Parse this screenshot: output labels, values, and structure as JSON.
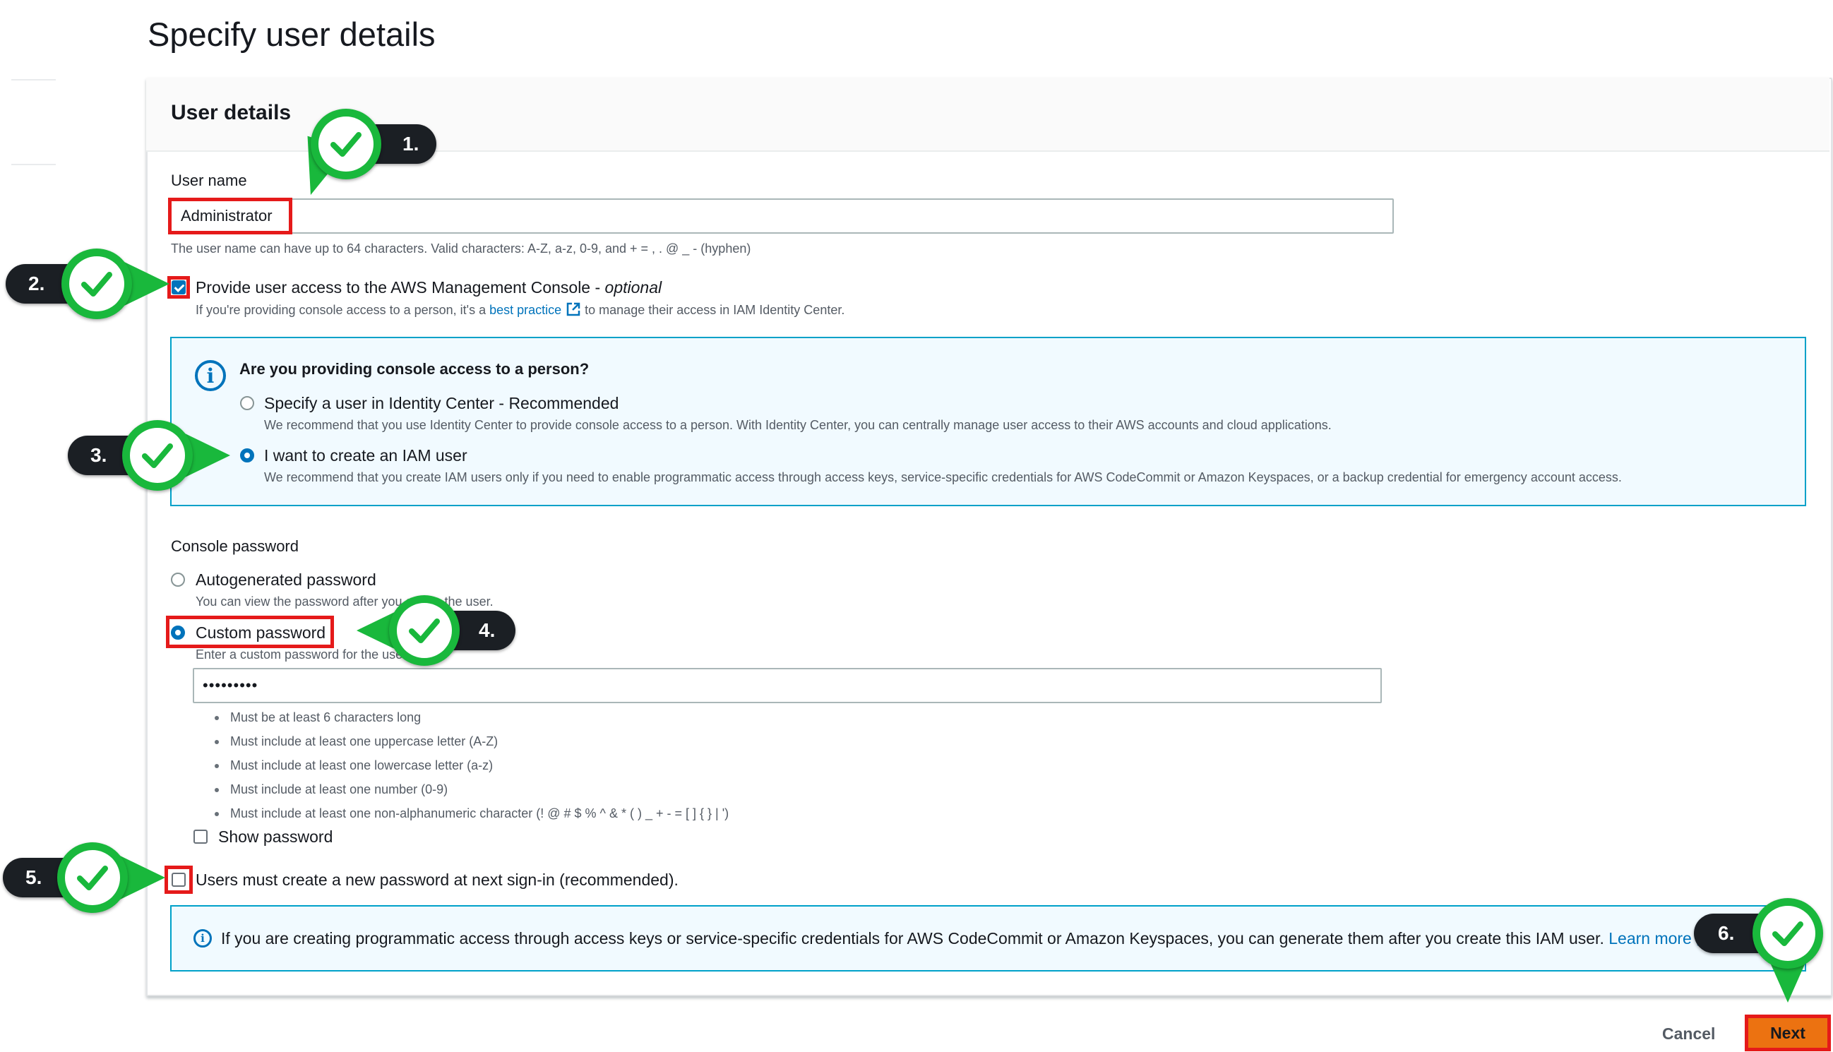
{
  "page_title": "Specify user details",
  "panel_title": "User details",
  "user_name": {
    "label": "User name",
    "value": "Administrator",
    "hint": "The user name can have up to 64 characters. Valid characters: A-Z, a-z, 0-9, and + = , . @ _ - (hyphen)"
  },
  "console_access": {
    "label": "Provide user access to the AWS Management Console - ",
    "label_optional": "optional",
    "checked": true,
    "hint_prefix": "If you're providing console access to a person, it's a ",
    "hint_link": "best practice",
    "hint_suffix": " to manage their access in IAM Identity Center."
  },
  "person_box": {
    "question": "Are you providing console access to a person?",
    "options": [
      {
        "label": "Specify a user in Identity Center - Recommended",
        "desc": "We recommend that you use Identity Center to provide console access to a person. With Identity Center, you can centrally manage user access to their AWS accounts and cloud applications.",
        "selected": false
      },
      {
        "label": "I want to create an IAM user",
        "desc": "We recommend that you create IAM users only if you need to enable programmatic access through access keys, service-specific credentials for AWS CodeCommit or Amazon Keyspaces, or a backup credential for emergency account access.",
        "selected": true
      }
    ]
  },
  "console_password": {
    "label": "Console password",
    "autogen_label": "Autogenerated password",
    "autogen_hint": "You can view the password after you create the user.",
    "custom_label": "Custom password",
    "custom_hint": "Enter a custom password for the user.",
    "selected": "custom",
    "value": "•••••••••",
    "rules": [
      "Must be at least 6 characters long",
      "Must include at least one uppercase letter (A-Z)",
      "Must include at least one lowercase letter (a-z)",
      "Must include at least one number (0-9)",
      "Must include at least one non-alphanumeric character (! @ # $ % ^ & * ( ) _ + - = [ ] { } | ')"
    ],
    "show_password_label": "Show password",
    "show_password_checked": false
  },
  "reset_password": {
    "label": "Users must create a new password at next sign-in (recommended).",
    "checked": false
  },
  "programmatic_info": {
    "text": "If you are creating programmatic access through access keys or service-specific credentials for AWS CodeCommit or Amazon Keyspaces, you can generate them after you create this IAM user.",
    "link": "Learn more"
  },
  "footer": {
    "cancel_label": "Cancel",
    "next_label": "Next"
  },
  "steps": [
    "1.",
    "2.",
    "3.",
    "4.",
    "5.",
    "6."
  ],
  "colors": {
    "accent_blue": "#0073bb",
    "primary_orange": "#ec7211",
    "highlight_red": "#e51a1a",
    "step_green": "#19b83c",
    "step_dark": "#1b1f24"
  }
}
